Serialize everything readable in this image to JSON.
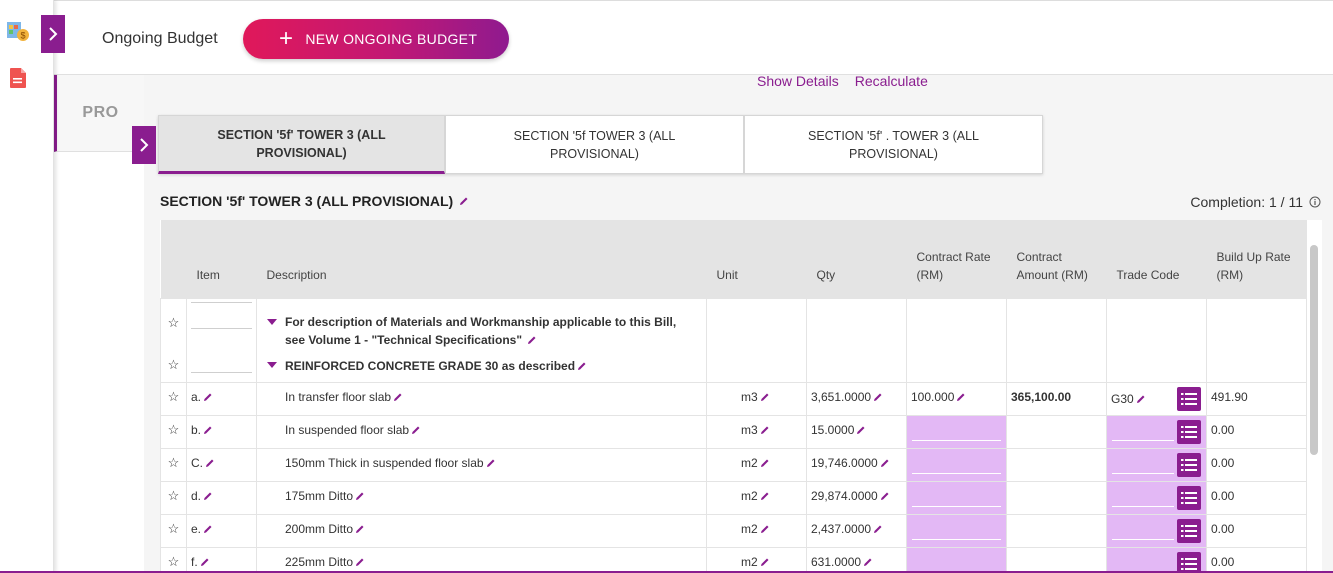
{
  "header": {
    "title": "Ongoing Budget",
    "new_button_label": "NEW ONGOING BUDGET"
  },
  "sidebar": {
    "pro_tab_label": "PRO"
  },
  "actions": {
    "show_details": "Show Details",
    "recalculate": "Recalculate"
  },
  "section_tabs": [
    {
      "label": "SECTION '5f' TOWER 3 (ALL PROVISIONAL)",
      "active": true
    },
    {
      "label": "SECTION '5f TOWER 3 (ALL PROVISIONAL)",
      "active": false
    },
    {
      "label": "SECTION '5f' . TOWER 3 (ALL PROVISIONAL)",
      "active": false
    }
  ],
  "section": {
    "title": "SECTION '5f' TOWER 3 (ALL PROVISIONAL)",
    "completion": "Completion: 1 / 11"
  },
  "table": {
    "columns": {
      "item": "Item",
      "description": "Description",
      "unit": "Unit",
      "qty": "Qty",
      "contract_rate": "Contract Rate (RM)",
      "contract_amount": "Contract Amount (RM)",
      "trade_code": "Trade Code",
      "build_up_rate": "Build Up Rate (RM)"
    },
    "header_notes": [
      "For description of Materials and Workmanship applicable to this Bill, see Volume 1 - \"Technical Specifications\"",
      "REINFORCED CONCRETE GRADE 30 as described"
    ],
    "rows": [
      {
        "item": "a.",
        "description": "In transfer floor slab",
        "unit": "m3",
        "qty": "3,651.0000",
        "contract_rate": "100.000",
        "contract_amount": "365,100.00",
        "trade_code": "G30",
        "build_up_rate": "491.90"
      },
      {
        "item": "b.",
        "description": "In suspended floor slab",
        "unit": "m3",
        "qty": "15.0000",
        "contract_rate": "",
        "contract_amount": "",
        "trade_code": "",
        "build_up_rate": "0.00"
      },
      {
        "item": "C.",
        "description": "150mm Thick in suspended floor slab",
        "unit": "m2",
        "qty": "19,746.0000",
        "contract_rate": "",
        "contract_amount": "",
        "trade_code": "",
        "build_up_rate": "0.00"
      },
      {
        "item": "d.",
        "description": "175mm Ditto",
        "unit": "m2",
        "qty": "29,874.0000",
        "contract_rate": "",
        "contract_amount": "",
        "trade_code": "",
        "build_up_rate": "0.00"
      },
      {
        "item": "e.",
        "description": "200mm Ditto",
        "unit": "m2",
        "qty": "2,437.0000",
        "contract_rate": "",
        "contract_amount": "",
        "trade_code": "",
        "build_up_rate": "0.00"
      },
      {
        "item": "f.",
        "description": "225mm Ditto",
        "unit": "m2",
        "qty": "631.0000",
        "contract_rate": "",
        "contract_amount": "",
        "trade_code": "",
        "build_up_rate": "0.00"
      }
    ]
  },
  "colors": {
    "accent": "#8a1d8f",
    "button_gradient_start": "#e0185a",
    "button_gradient_end": "#8f1a8f",
    "editable_cell": "#e3b8f5"
  }
}
